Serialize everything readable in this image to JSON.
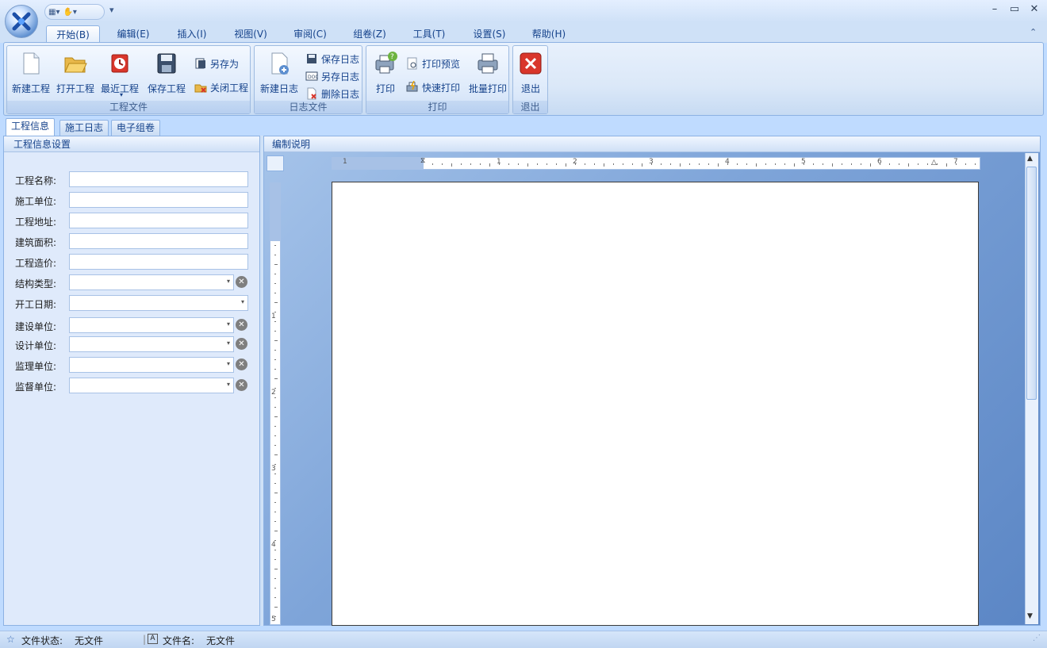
{
  "window": {
    "controls": [
      "–",
      "▭",
      "✕"
    ]
  },
  "qat": {
    "more": "▾"
  },
  "menu_tabs": [
    {
      "label": "开始(B)",
      "active": true
    },
    {
      "label": "编辑(E)"
    },
    {
      "label": "插入(I)"
    },
    {
      "label": "视图(V)"
    },
    {
      "label": "审阅(C)"
    },
    {
      "label": "组卷(Z)"
    },
    {
      "label": "工具(T)"
    },
    {
      "label": "设置(S)"
    },
    {
      "label": "帮助(H)"
    }
  ],
  "ribbon": {
    "groups": {
      "project": {
        "label": "工程文件",
        "new": "新建工程",
        "open": "打开工程",
        "recent": "最近工程",
        "save": "保存工程",
        "save_as": "另存为",
        "close": "关闭工程"
      },
      "log": {
        "label": "日志文件",
        "new": "新建日志",
        "save": "保存日志",
        "save_as": "另存日志",
        "delete": "删除日志"
      },
      "print": {
        "label": "打印",
        "print": "打印",
        "preview": "打印预览",
        "quick": "快速打印",
        "batch": "批量打印"
      },
      "exit": {
        "label": "退出",
        "exit": "退出"
      }
    }
  },
  "doc_tabs": [
    {
      "label": "工程信息",
      "active": true
    },
    {
      "label": "施工日志"
    },
    {
      "label": "电子组卷"
    }
  ],
  "left_panel": {
    "title": "工程信息设置",
    "fields": [
      {
        "label": "工程名称:",
        "type": "text",
        "value": ""
      },
      {
        "label": "施工单位:",
        "type": "text",
        "value": ""
      },
      {
        "label": "工程地址:",
        "type": "text",
        "value": ""
      },
      {
        "label": "建筑面积:",
        "type": "text",
        "value": ""
      },
      {
        "label": "工程造价:",
        "type": "text",
        "value": ""
      },
      {
        "label": "结构类型:",
        "type": "combo-clear",
        "value": ""
      },
      {
        "label": "开工日期:",
        "type": "date",
        "value": ""
      },
      {
        "label": "建设单位:",
        "type": "combo-clear",
        "value": ""
      },
      {
        "label": "设计单位:",
        "type": "combo-clear",
        "value": ""
      },
      {
        "label": "监理单位:",
        "type": "combo-clear",
        "value": ""
      },
      {
        "label": "监督单位:",
        "type": "combo-clear",
        "value": ""
      }
    ]
  },
  "right_panel": {
    "title": "编制说明",
    "ruler_numbers": [
      "1",
      "1",
      "2",
      "3",
      "4",
      "5",
      "6",
      "7"
    ],
    "vruler_numbers": [
      "1",
      "2",
      "3",
      "4",
      "5"
    ]
  },
  "status": {
    "file_state_label": "文件状态:",
    "file_state_value": "无文件",
    "file_name_label": "文件名:",
    "file_name_value": "无文件"
  },
  "colors": {
    "accent": "#15428b",
    "ribbon_bg": "#dbe8f8",
    "frame": "#bfdbff",
    "exit_red": "#d9362b"
  }
}
